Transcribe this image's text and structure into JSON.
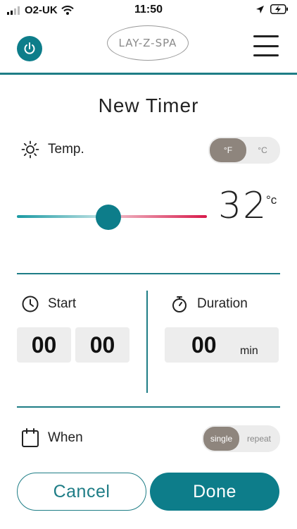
{
  "status_bar": {
    "carrier": "O2-UK",
    "time": "11:50"
  },
  "header": {
    "logo_text": "LAY-Z-SPA"
  },
  "page": {
    "title": "New Timer"
  },
  "temperature": {
    "label": "Temp.",
    "unit_options": [
      "°F",
      "°C"
    ],
    "selected_unit": "°F",
    "value": "32",
    "value_unit": "°c",
    "slider_fraction": 0.48
  },
  "start": {
    "label": "Start",
    "hours": "00",
    "minutes": "00"
  },
  "duration": {
    "label": "Duration",
    "value": "00",
    "unit": "min"
  },
  "when": {
    "label": "When",
    "options": [
      "single",
      "repeat"
    ],
    "selected": "single"
  },
  "actions": {
    "cancel_label": "Cancel",
    "done_label": "Done"
  },
  "colors": {
    "accent": "#0d7d8a",
    "divider": "#1e7d86",
    "slider_hot": "#d8194a",
    "toggle_active": "#8e857d"
  }
}
